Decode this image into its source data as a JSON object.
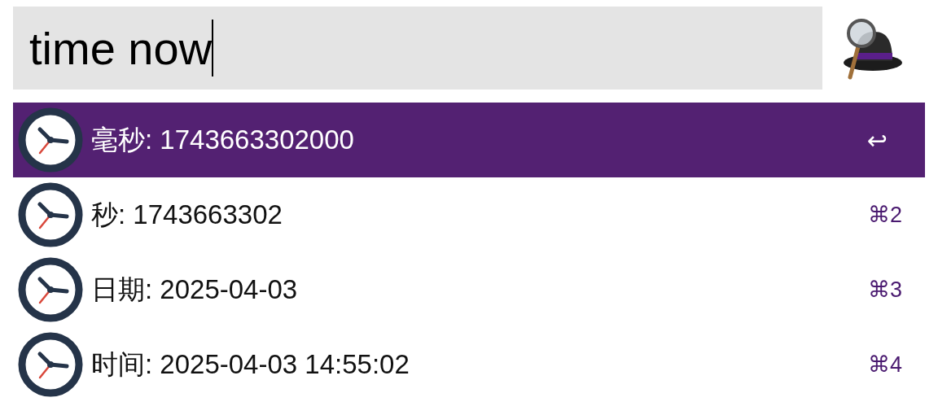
{
  "search": {
    "value": "time now"
  },
  "results": [
    {
      "title": "毫秒: 1743663302000",
      "shortcut": "↩",
      "selected": true
    },
    {
      "title": "秒: 1743663302",
      "shortcut": "⌘2",
      "selected": false
    },
    {
      "title": "日期: 2025-04-03",
      "shortcut": "⌘3",
      "selected": false
    },
    {
      "title": "时间: 2025-04-03 14:55:02",
      "shortcut": "⌘4",
      "selected": false
    }
  ]
}
